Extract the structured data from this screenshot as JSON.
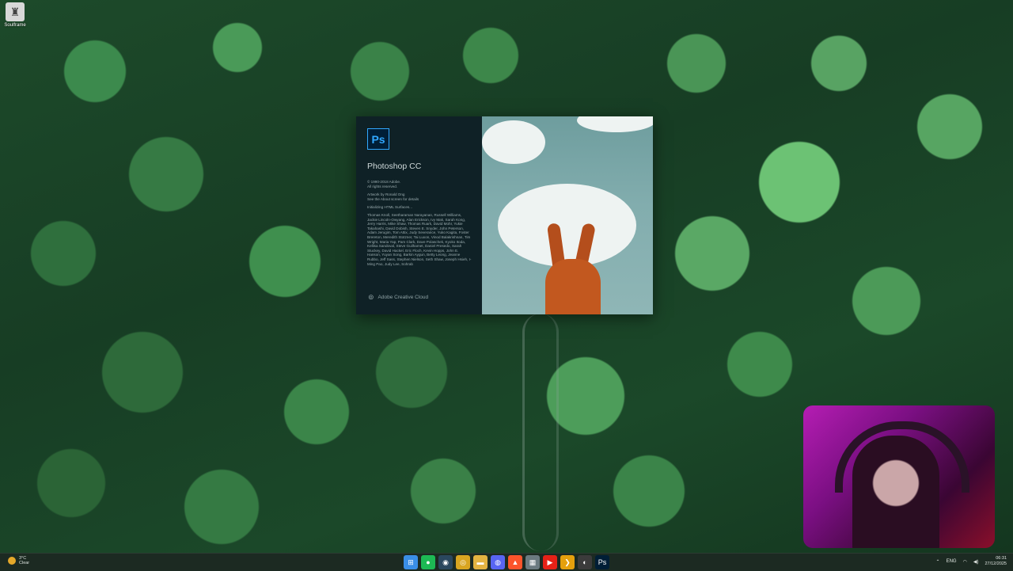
{
  "desktop": {
    "icons": [
      {
        "label": "Soulframe",
        "icon": "game-icon"
      }
    ]
  },
  "splash": {
    "logo_text": "Ps",
    "product_name": "Photoshop CC",
    "copyright_lines": [
      "© 1990-2018 Adobe.",
      "All rights reserved."
    ],
    "artwork_lines": [
      "Artwork by Ronald Ong",
      "See the About screen for details"
    ],
    "status_text": "Initializing HTML Surfaces...",
    "credits": "Thomas Knoll, Seetharaman Narayanan, Russell Williams, Jackie Lincoln-Owyang, Alan Erickson, Ivy Mak, Sarah Kong, Jerry Harris, Mike Shaw, Thomas Ruark, David Mohr, Yukie Takahashi, David Dobish, Steven E. Snyder, John Peterson, Adam Jerugim, Tom Attix, Judy Severance, Yuko Kagita, Foster Brereton, Meredith Stotzner, Tai Luxon, Vinod Balakrishnan, Tim Wright, Maria Yap, Pam Clark, Dave Polaschek, Kyoko Itoda, Kellisa Sandoval, Steve Guilhamet, Daniel Presedo, Sarah Stuckey, David Hackel, Eric Floch, Kevin Hopps, John E. Hanson, Yuyan Song, Barkin Aygun, Betty Leong, Jeanne Rubbo, Jeff Sass, Stephen Nielson, Seth Shaw, Joseph Hsieh, I-Ming Pao, Judy Lee, Sohrab",
    "footer_label": "Adobe Creative Cloud",
    "accent": "#31a8ff"
  },
  "taskbar": {
    "weather": {
      "temp": "3°C",
      "condition": "Clear"
    },
    "apps": [
      {
        "name": "start-button",
        "icon": "windows-icon",
        "glyph": "⊞",
        "color": "#3a8ee6"
      },
      {
        "name": "spotify-app",
        "icon": "spotify-icon",
        "glyph": "●",
        "color": "#1db954"
      },
      {
        "name": "steam-app",
        "icon": "steam-icon",
        "glyph": "◉",
        "color": "#2a475e"
      },
      {
        "name": "chrome-app",
        "icon": "chrome-icon",
        "glyph": "◎",
        "color": "#d9a521"
      },
      {
        "name": "files-app",
        "icon": "folder-icon",
        "glyph": "▬",
        "color": "#e3b341"
      },
      {
        "name": "discord-app",
        "icon": "discord-icon",
        "glyph": "◍",
        "color": "#5865f2"
      },
      {
        "name": "brave-app",
        "icon": "brave-icon",
        "glyph": "▲",
        "color": "#fb542b"
      },
      {
        "name": "calendar-app",
        "icon": "calendar-icon",
        "glyph": "▦",
        "color": "#6b7a80"
      },
      {
        "name": "youtube-app",
        "icon": "youtube-icon",
        "glyph": "▶",
        "color": "#e62117"
      },
      {
        "name": "plex-app",
        "icon": "plex-icon",
        "glyph": "❯",
        "color": "#e5a00d"
      },
      {
        "name": "obs-app",
        "icon": "obs-icon",
        "glyph": "◐",
        "color": "#3b3b3b"
      },
      {
        "name": "photoshop-app",
        "icon": "photoshop-icon",
        "glyph": "Ps",
        "color": "#001e36"
      }
    ],
    "tray": {
      "language": "ENG",
      "time": "06:31",
      "date": "27/12/2025"
    }
  }
}
